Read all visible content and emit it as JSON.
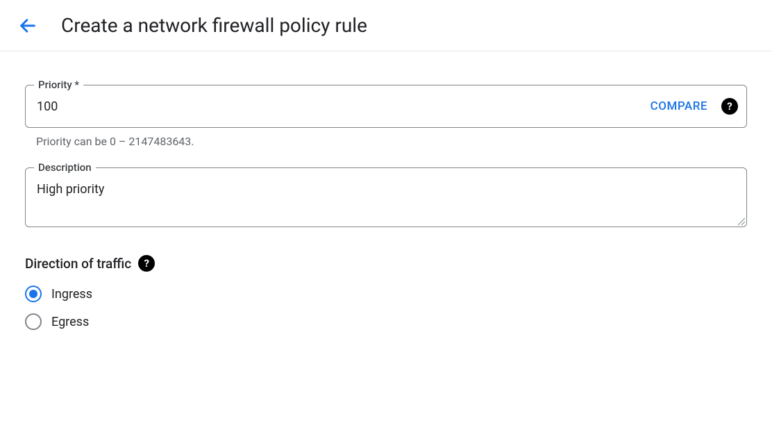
{
  "header": {
    "title": "Create a network firewall policy rule"
  },
  "priority": {
    "label": "Priority *",
    "value": "100",
    "compare": "COMPARE",
    "helper": "Priority can be 0 – 2147483643."
  },
  "description": {
    "label": "Description",
    "value": "High priority"
  },
  "direction": {
    "label": "Direction of traffic",
    "options": [
      {
        "label": "Ingress",
        "selected": true
      },
      {
        "label": "Egress",
        "selected": false
      }
    ]
  }
}
